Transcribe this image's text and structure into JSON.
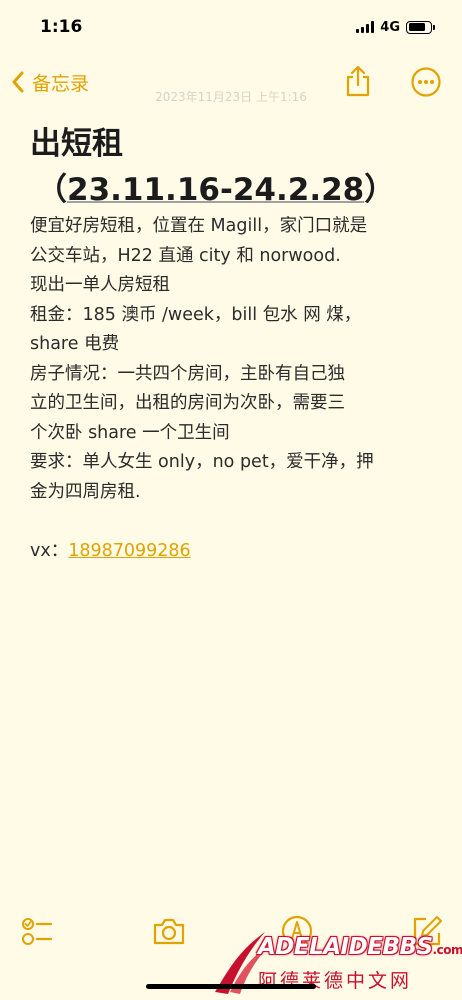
{
  "status_bar": {
    "time": "1:16",
    "network": "4G",
    "battery_level": 0.8
  },
  "nav": {
    "back_label": "备忘录",
    "icons": [
      "chevron-left-icon",
      "share-icon",
      "more-icon"
    ]
  },
  "note": {
    "date": "2023年11月23日 上午1:16",
    "title": "出短租",
    "subtitle_open": "（",
    "subtitle_dates": "23.11.16-24.2.28",
    "subtitle_close": "）",
    "body_lines": [
      "便宜好房短租，位置在 Magill，家门口就是",
      "公交车站，H22 直通 city 和 norwood.",
      "现出一单人房短租",
      "租金：185 澳币 /week，bill 包水 网 煤，",
      "share 电费",
      "房子情况：一共四个房间，主卧有自己独",
      "立的卫生间，出租的房间为次卧，需要三",
      "个次卧 share 一个卫生间",
      "要求：单人女生 only，no pet，爱干净，押",
      "金为四周房租."
    ],
    "contact_label": "vx：",
    "contact_phone": "18987099286"
  },
  "toolbar": {
    "icons": [
      "checklist-icon",
      "camera-icon",
      "markup-icon",
      "compose-icon"
    ]
  },
  "watermark": {
    "brand": "ADELAIDEBBS",
    "domain": ".com",
    "chinese_name": "阿德莱德中文网"
  },
  "colors": {
    "accent": "#e1a300",
    "background": "#fffbe6",
    "watermark_red": "#c8102e"
  }
}
